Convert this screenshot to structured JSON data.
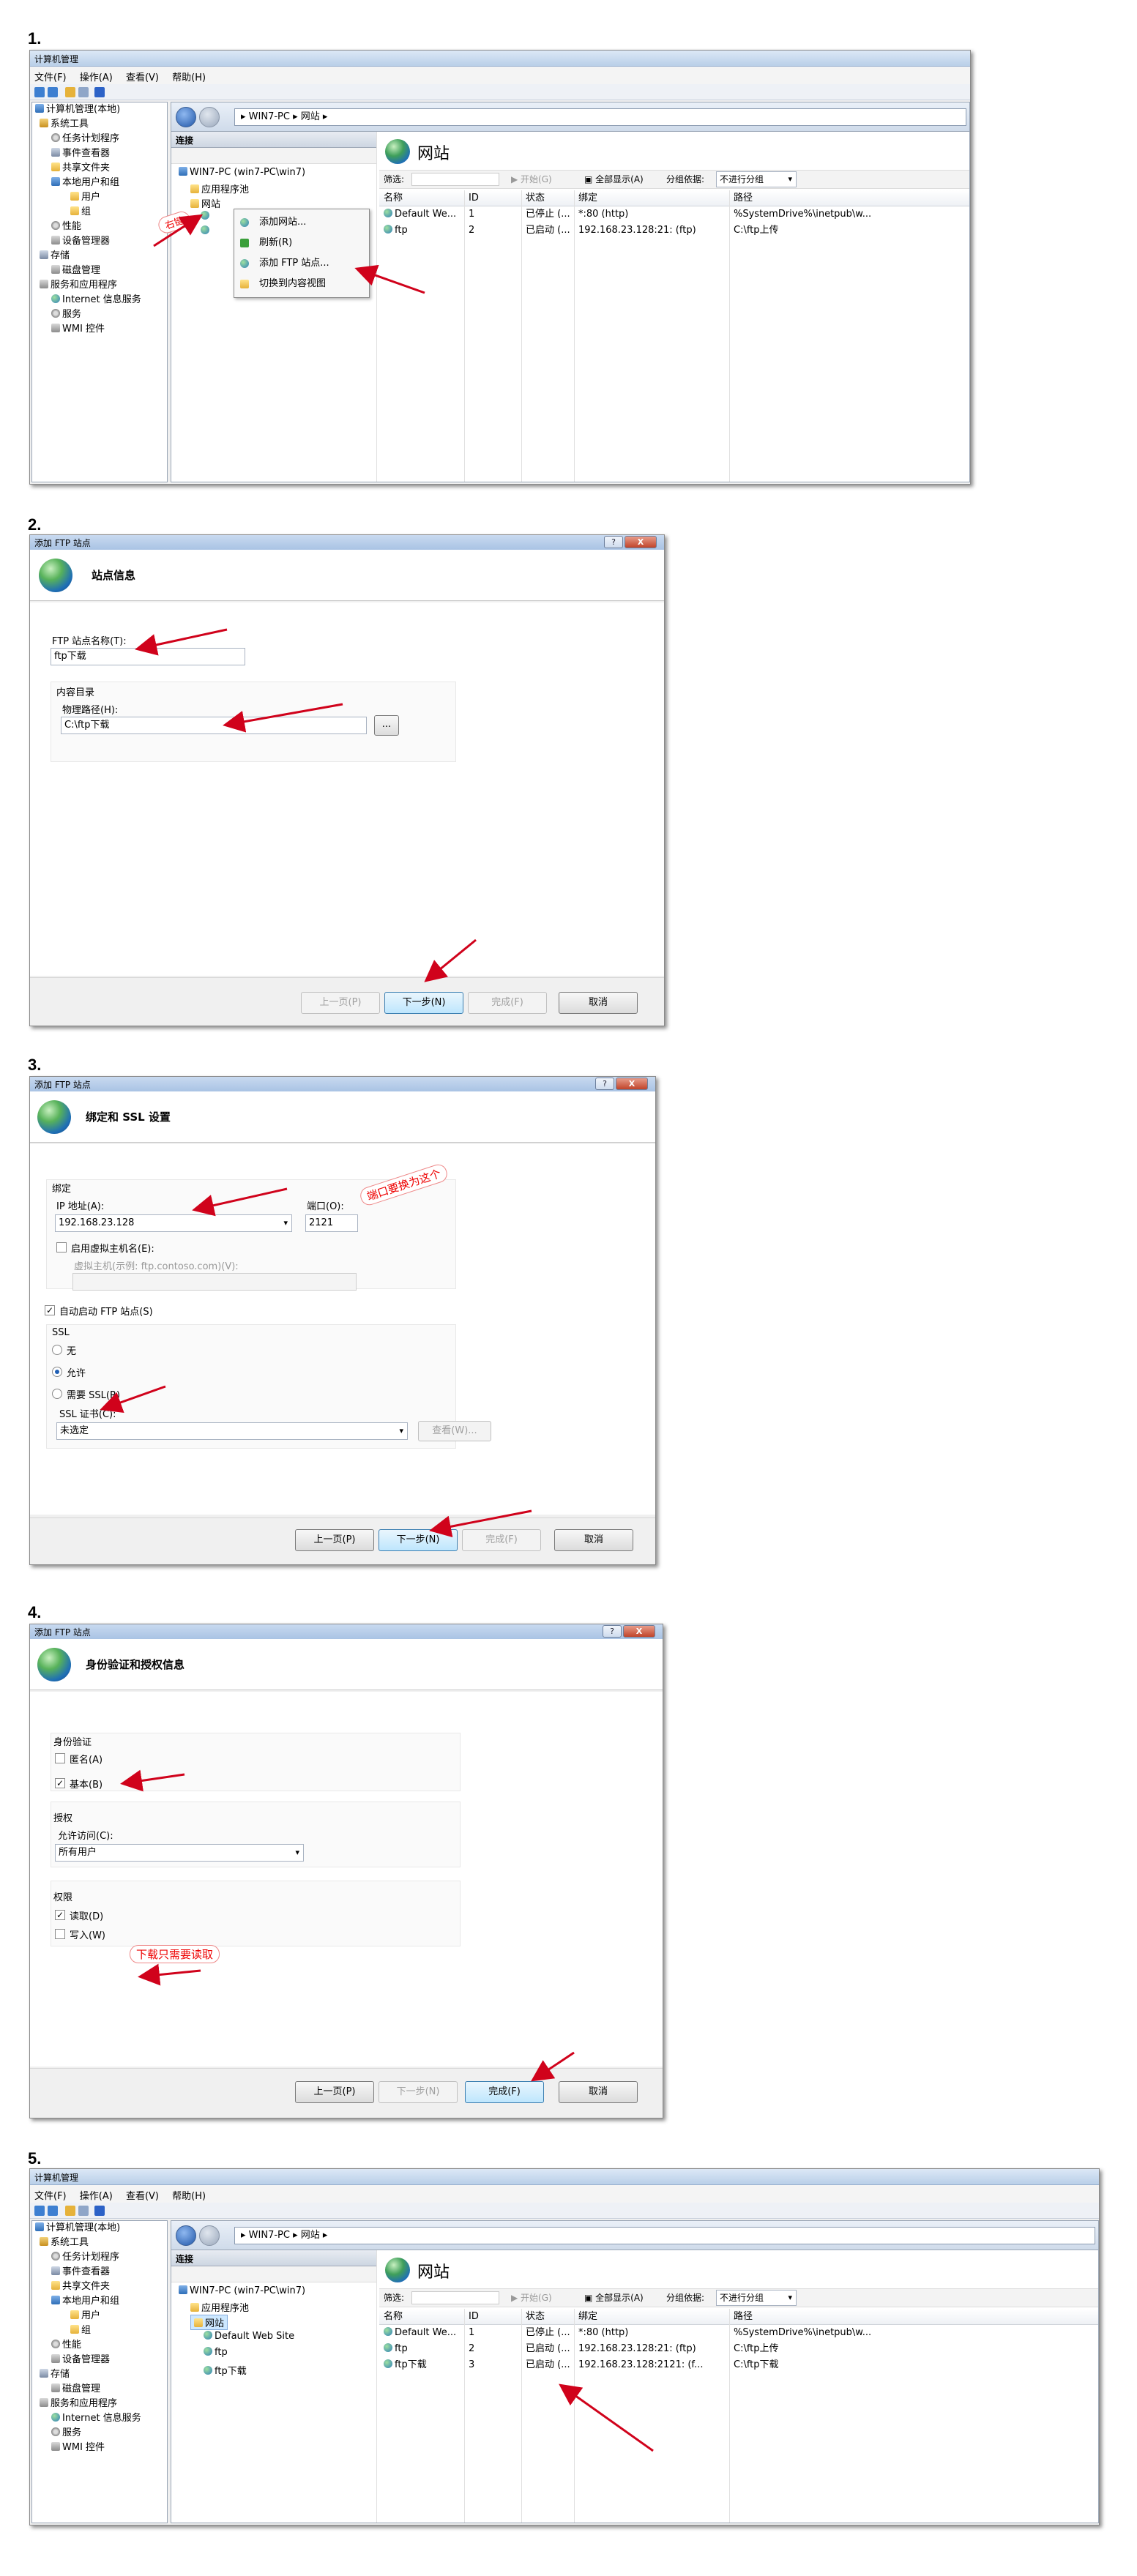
{
  "steps": [
    "1.",
    "2.",
    "3.",
    "4.",
    "5."
  ],
  "colors": {
    "arrow": "#d0021b",
    "accent": "#3c7fb1",
    "title_bar": "#b9cfe8"
  },
  "mmc": {
    "title": "计算机管理",
    "menu": [
      "文件(F)",
      "操作(A)",
      "查看(V)",
      "帮助(H)"
    ],
    "tree": {
      "root": "计算机管理(本地)",
      "system_tools": "系统工具",
      "task_scheduler": "任务计划程序",
      "event_viewer": "事件查看器",
      "shared_folders": "共享文件夹",
      "local_users": "本地用户和组",
      "users": "用户",
      "groups": "组",
      "performance": "性能",
      "device_manager": "设备管理器",
      "storage": "存储",
      "disk_mgmt": "磁盘管理",
      "services_apps": "服务和应用程序",
      "iis": "Internet 信息服务",
      "services": "服务",
      "wmi": "WMI 控件"
    }
  },
  "iis": {
    "breadcrumb": [
      "WIN7-PC",
      "网站"
    ],
    "connections": "连接",
    "server": "WIN7-PC (win7-PC\\win7)",
    "app_pools": "应用程序池",
    "sites_short": "网站",
    "sites_title": "网站",
    "filter_label": "筛选:",
    "start": "开始(G)",
    "show_all": "全部显示(A)",
    "group_by": "分组依据:",
    "no_group": "不进行分组",
    "columns": [
      "名称",
      "ID",
      "状态",
      "绑定",
      "路径"
    ],
    "rows_step1": [
      [
        "Default We...",
        "1",
        "已停止 (...",
        "*:80 (http)",
        "%SystemDrive%\\inetpub\\w..."
      ],
      [
        "ftp",
        "2",
        "已启动 (...",
        "192.168.23.128:21: (ftp)",
        "C:\\ftp上传"
      ]
    ],
    "rows_step5": [
      [
        "Default We...",
        "1",
        "已停止 (...",
        "*:80 (http)",
        "%SystemDrive%\\inetpub\\w..."
      ],
      [
        "ftp",
        "2",
        "已启动 (...",
        "192.168.23.128:21: (ftp)",
        "C:\\ftp上传"
      ],
      [
        "ftp下载",
        "3",
        "已启动 (...",
        "192.168.23.128:2121: (f...",
        "C:\\ftp下载"
      ]
    ],
    "tree_sites_step5": [
      "Default Web Site",
      "ftp",
      "ftp下载"
    ],
    "context_menu": [
      "添加网站...",
      "刷新(R)",
      "添加 FTP 站点...",
      "切换到内容视图"
    ],
    "right_click_note": "右键"
  },
  "dialog_title": "添加 FTP 站点",
  "title_buttons": {
    "help": "?",
    "close": "X"
  },
  "buttons": {
    "prev": "上一页(P)",
    "next": "下一步(N)",
    "finish": "完成(F)",
    "cancel": "取消"
  },
  "step2": {
    "header": "站点信息",
    "site_name_label": "FTP 站点名称(T):",
    "site_name": "ftp下载",
    "content_dir": "内容目录",
    "physical_path_label": "物理路径(H):",
    "physical_path": "C:\\ftp下载",
    "browse": "..."
  },
  "step3": {
    "header": "绑定和 SSL 设置",
    "binding": "绑定",
    "ip_label": "IP 地址(A):",
    "ip": "192.168.23.128",
    "port_label": "端口(O):",
    "port": "2121",
    "port_note": "端口要换为这个",
    "virtual_host_enable": "启用虚拟主机名(E):",
    "virtual_host_label": "虚拟主机(示例: ftp.contoso.com)(V):",
    "auto_start": "自动启动 FTP 站点(S)",
    "ssl": "SSL",
    "ssl_none": "无",
    "ssl_allow": "允许",
    "ssl_require": "需要 SSL(R)",
    "cert_label": "SSL 证书(C):",
    "cert": "未选定",
    "view": "查看(W)..."
  },
  "step4": {
    "header": "身份验证和授权信息",
    "auth": "身份验证",
    "anonymous": "匿名(A)",
    "basic": "基本(B)",
    "authorization": "授权",
    "allow_access_label": "允许访问(C):",
    "allow_access": "所有用户",
    "permissions": "权限",
    "read": "读取(D)",
    "write": "写入(W)",
    "read_note": "下载只需要读取"
  }
}
